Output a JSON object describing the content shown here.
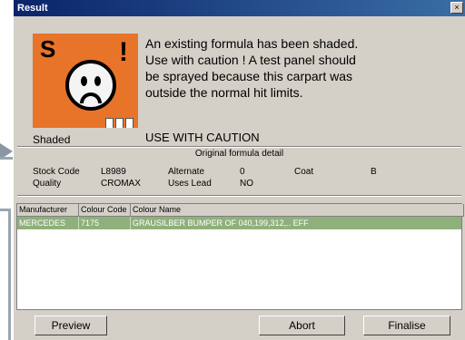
{
  "window": {
    "title": "Result",
    "close_glyph": "×"
  },
  "icon": {
    "letter": "S",
    "exclamation": "!",
    "icon_name": "shaded-warning-face-icon"
  },
  "status": {
    "label": "Shaded"
  },
  "message": {
    "text": "An existing formula has been shaded. Use with caution ! A test panel should be sprayed because this carpart was outside the normal hit limits.",
    "caution": "USE WITH CAUTION"
  },
  "formula": {
    "heading": "Original formula detail",
    "stock_code_label": "Stock Code",
    "stock_code_value": "L8989",
    "alternate_label": "Alternate",
    "alternate_value": "0",
    "coat_label": "Coat",
    "coat_value": "B",
    "quality_label": "Quality",
    "quality_value": "CROMAX",
    "uses_lead_label": "Uses Lead",
    "uses_lead_value": "NO"
  },
  "table": {
    "columns": [
      "Manufacturer",
      "Colour Code",
      "Colour Name"
    ],
    "rows": [
      [
        "MERCEDES",
        "7175",
        "GRAUSILBER BUMPER OF 040,199,312,.. EFF"
      ]
    ]
  },
  "buttons": {
    "preview": "Preview",
    "abort": "Abort",
    "finalise": "Finalise"
  },
  "colors": {
    "title_bar": "#0a246a",
    "selected_row": "#8fb07a",
    "icon_bg": "#e8742a",
    "dialog_bg": "#d4d0c8"
  }
}
